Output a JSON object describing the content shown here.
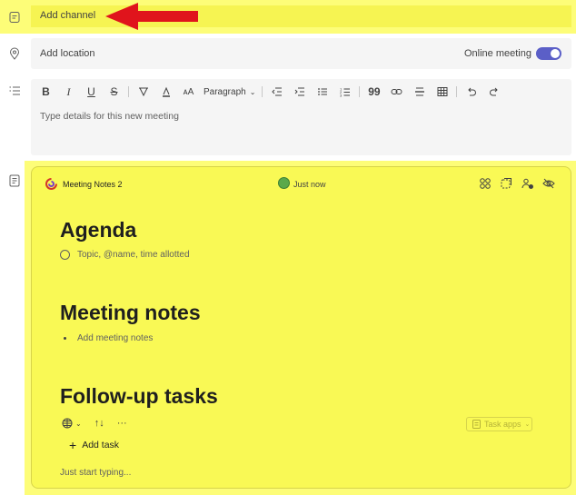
{
  "channel": {
    "placeholder": "Add channel"
  },
  "location": {
    "placeholder": "Add location",
    "online_label": "Online meeting",
    "online_on": true
  },
  "editor": {
    "toolbar": {
      "bold": "B",
      "italic": "I",
      "underline": "U",
      "strike": "S",
      "paragraph": "Paragraph"
    },
    "placeholder": "Type details for this new meeting"
  },
  "loop": {
    "title": "Meeting Notes 2",
    "status": "Just now",
    "agenda": {
      "heading": "Agenda",
      "item": "Topic, @name, time allotted"
    },
    "notes": {
      "heading": "Meeting notes",
      "item": "Add meeting notes"
    },
    "tasks": {
      "heading": "Follow-up tasks",
      "task_apps": "Task apps",
      "add_task": "Add task",
      "more": "···"
    },
    "start_typing": "Just start typing..."
  },
  "colors": {
    "highlight": "#fdfd78",
    "accent": "#5b5fc7",
    "arrow": "#e0141c"
  }
}
